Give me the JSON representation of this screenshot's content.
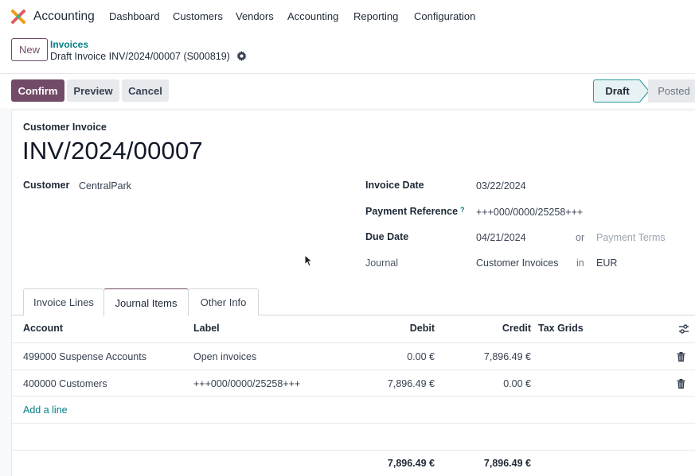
{
  "app": {
    "name": "Accounting",
    "menu": [
      "Dashboard",
      "Customers",
      "Vendors",
      "Accounting",
      "Reporting",
      "Configuration"
    ]
  },
  "control": {
    "new_label": "New",
    "breadcrumb_parent": "Invoices",
    "breadcrumb_current": "Draft Invoice INV/2024/00007 (S000819)"
  },
  "actions": {
    "confirm": "Confirm",
    "preview": "Preview",
    "cancel": "Cancel"
  },
  "status": {
    "stages": [
      "Draft",
      "Posted"
    ],
    "current": "Draft"
  },
  "form": {
    "doc_type": "Customer Invoice",
    "doc_name": "INV/2024/00007",
    "customer_label": "Customer",
    "customer_value": "CentralPark",
    "invoice_date_label": "Invoice Date",
    "invoice_date_value": "03/22/2024",
    "payment_ref_label": "Payment Reference",
    "payment_ref_help": "?",
    "payment_ref_value": "+++000/0000/25258+++",
    "due_date_label": "Due Date",
    "due_date_value": "04/21/2024",
    "or_label": "or",
    "payment_terms_placeholder": "Payment Terms",
    "journal_label": "Journal",
    "journal_value": "Customer Invoices",
    "in_label": "in",
    "currency_value": "EUR"
  },
  "tabs": [
    "Invoice Lines",
    "Journal Items",
    "Other Info"
  ],
  "active_tab": "Journal Items",
  "table": {
    "headers": {
      "account": "Account",
      "label": "Label",
      "debit": "Debit",
      "credit": "Credit",
      "tax_grids": "Tax Grids"
    },
    "rows": [
      {
        "account": "499000 Suspense Accounts",
        "label": "Open invoices",
        "debit": "0.00 €",
        "credit": "7,896.49 €"
      },
      {
        "account": "400000 Customers",
        "label": "+++000/0000/25258+++",
        "debit": "7,896.49 €",
        "credit": "0.00 €"
      }
    ],
    "add_line": "Add a line",
    "total_debit": "7,896.49 €",
    "total_credit": "7,896.49 €"
  },
  "colors": {
    "brand": "#714b67",
    "link": "#017e84",
    "status_active_border": "#2a9a9f"
  },
  "icons": [
    "app-logo-icon",
    "gear-icon",
    "optional-columns-icon",
    "trash-icon",
    "mouse-cursor-icon"
  ]
}
